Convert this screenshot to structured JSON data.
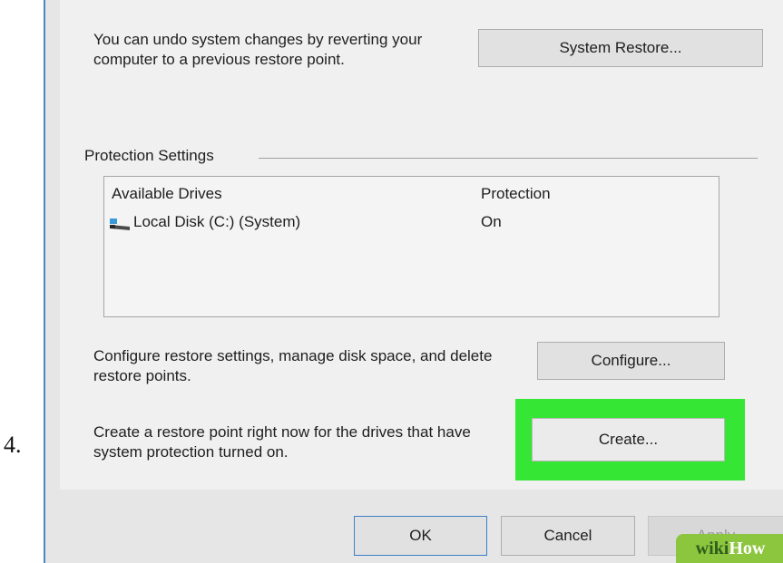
{
  "step": {
    "number": "4."
  },
  "restore": {
    "description": "You can undo system changes by reverting your computer to a previous restore point.",
    "button_label": "System Restore..."
  },
  "protection": {
    "group_label": "Protection Settings",
    "columns": [
      "Available Drives",
      "Protection"
    ],
    "drives": [
      {
        "name": "Local Disk (C:) (System)",
        "protection": "On",
        "icon": "drive-icon"
      }
    ]
  },
  "configure": {
    "description": "Configure restore settings, manage disk space, and delete restore points.",
    "button_label": "Configure..."
  },
  "create": {
    "description": "Create a restore point right now for the drives that have system protection turned on.",
    "button_label": "Create...",
    "highlight_color": "#35e635"
  },
  "footer": {
    "ok_label": "OK",
    "cancel_label": "Cancel",
    "apply_label": "Apply"
  },
  "watermark": {
    "part1": "wiki",
    "part2": "How"
  }
}
